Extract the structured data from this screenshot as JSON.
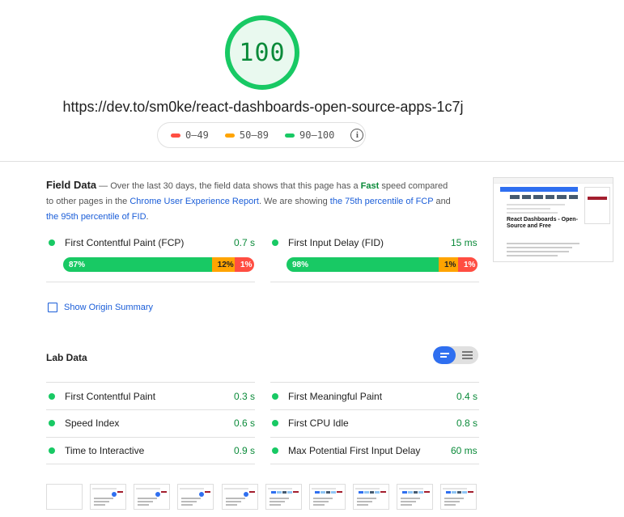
{
  "score": "100",
  "url": "https://dev.to/sm0ke/react-dashboards-open-source-apps-1c7j",
  "legend": [
    {
      "label": "0–49",
      "color": "#ff4e42"
    },
    {
      "label": "50–89",
      "color": "#ffa400"
    },
    {
      "label": "90–100",
      "color": "#18c964"
    }
  ],
  "legend_info_icon": "info-icon",
  "field_data": {
    "title": "Field Data",
    "desc_1": " — Over the last 30 days, the field data shows that this page has a ",
    "fast": "Fast",
    "desc_2": " speed compared to other pages in the ",
    "report_link": "Chrome User Experience Report",
    "desc_3": ". We are showing ",
    "fcp_link": "the 75th percentile of FCP",
    "desc_4": " and ",
    "fid_link": "the 95th percentile of FID",
    "desc_5": ".",
    "thumbnail_title": "React Dashboards - Open-Source and Free",
    "metrics": [
      {
        "name": "First Contentful Paint (FCP)",
        "value": "0.7 s",
        "good": "87%",
        "avg": "12%",
        "poor": "1%",
        "good_frac": 0.87,
        "avg_frac": 0.12,
        "poor_frac": 0.01
      },
      {
        "name": "First Input Delay (FID)",
        "value": "15 ms",
        "good": "98%",
        "avg": "1%",
        "poor": "1%",
        "good_frac": 0.98,
        "avg_frac": 0.01,
        "poor_frac": 0.01
      }
    ]
  },
  "origin_summary": "Show Origin Summary",
  "lab_data": {
    "title": "Lab Data",
    "metrics": [
      {
        "name": "First Contentful Paint",
        "value": "0.3 s"
      },
      {
        "name": "First Meaningful Paint",
        "value": "0.4 s"
      },
      {
        "name": "Speed Index",
        "value": "0.6 s"
      },
      {
        "name": "First CPU Idle",
        "value": "0.8 s"
      },
      {
        "name": "Time to Interactive",
        "value": "0.9 s"
      },
      {
        "name": "Max Potential First Input Delay",
        "value": "60 ms"
      }
    ]
  },
  "colors": {
    "good": "#18c964",
    "average": "#ffa400",
    "poor": "#ff4e42",
    "link": "#1a5dd8",
    "accent": "#2f6ff0"
  }
}
